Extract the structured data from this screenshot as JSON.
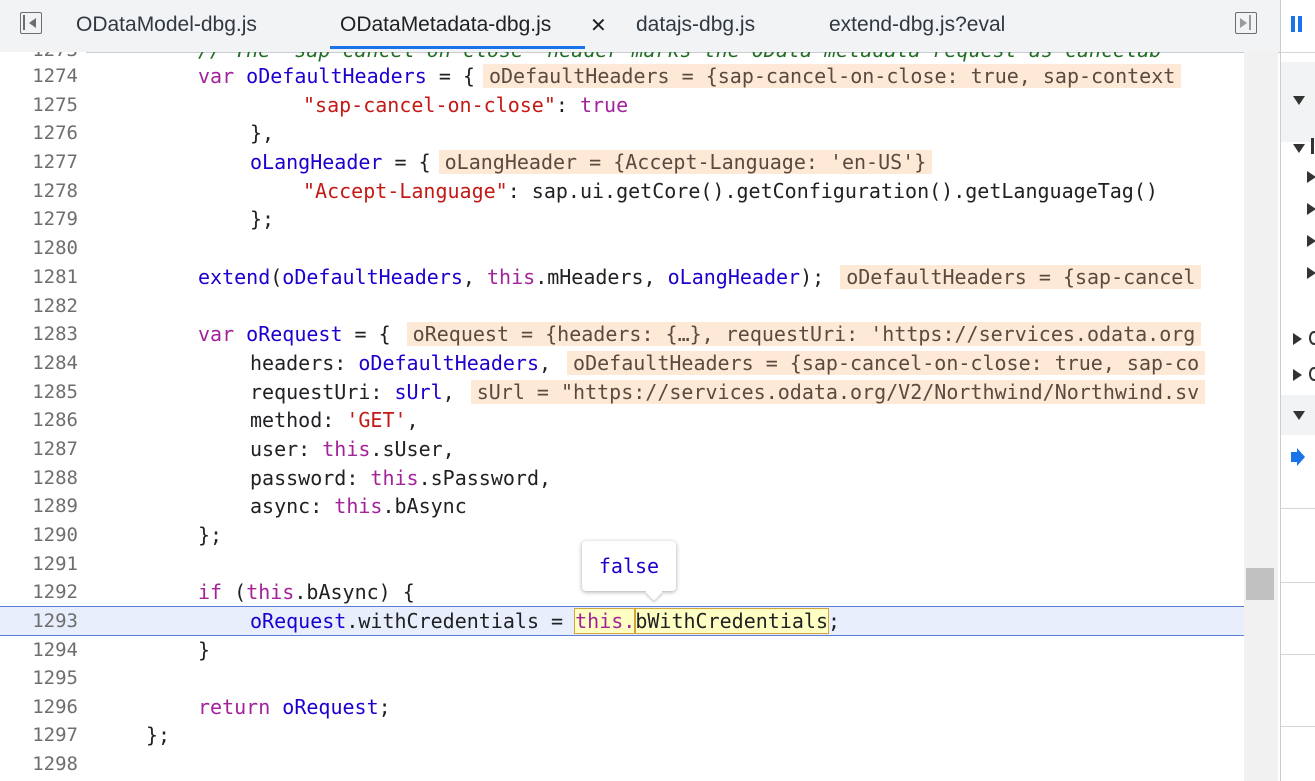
{
  "tabs": [
    {
      "label": "ODataModel-dbg.js"
    },
    {
      "label": "ODataMetadata-dbg.js",
      "active": true,
      "close": "✕"
    },
    {
      "label": "datajs-dbg.js"
    },
    {
      "label": "extend-dbg.js?eval"
    }
  ],
  "editor": {
    "partial_top_line": {
      "num": "1273",
      "text": "// The \"sap-cancel-on-close\" header marks the OData metadata request as cancelab"
    },
    "lines": [
      {
        "num": "1274"
      },
      {
        "num": "1275"
      },
      {
        "num": "1276"
      },
      {
        "num": "1277"
      },
      {
        "num": "1278"
      },
      {
        "num": "1279"
      },
      {
        "num": "1280"
      },
      {
        "num": "1281"
      },
      {
        "num": "1282"
      },
      {
        "num": "1283"
      },
      {
        "num": "1284"
      },
      {
        "num": "1285"
      },
      {
        "num": "1286"
      },
      {
        "num": "1287"
      },
      {
        "num": "1288"
      },
      {
        "num": "1289"
      },
      {
        "num": "1290"
      },
      {
        "num": "1291"
      },
      {
        "num": "1292"
      },
      {
        "num": "1293"
      },
      {
        "num": "1294"
      },
      {
        "num": "1295"
      },
      {
        "num": "1296"
      },
      {
        "num": "1297"
      },
      {
        "num": "1298"
      }
    ],
    "current_line": "1293",
    "inline_values": {
      "l1274": "oDefaultHeaders = {sap-cancel-on-close: true, sap-context",
      "l1277": "oLangHeader = {Accept-Language: 'en-US'}",
      "l1281": "oDefaultHeaders = {sap-cancel",
      "l1283": "oRequest = {headers: {…}, requestUri: 'https://services.odata.org",
      "l1284": "oDefaultHeaders = {sap-cancel-on-close: true, sap-co",
      "l1285": "sUrl = \"https://services.odata.org/V2/Northwind/Northwind.sv"
    },
    "tooltip": "false"
  },
  "colors": {
    "keyword": "#a2239a",
    "string": "#c41a16",
    "variable": "#1c00cf",
    "comment": "#236e25",
    "current_line_bg": "#e8eefb",
    "inline_value_bg": "#fde9d6",
    "tab_accent": "#1a73e8"
  },
  "icons": {
    "left_nav": "toggle-navigator-icon",
    "right_nav": "toggle-debugger-sidebar-icon",
    "pause": "pause-icon",
    "current_frame": "current-frame-arrow-icon"
  }
}
